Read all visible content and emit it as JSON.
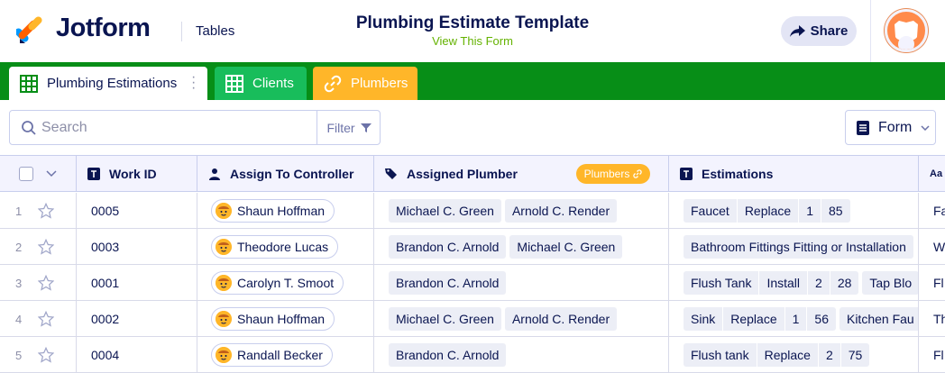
{
  "header": {
    "brand": "Jotform",
    "section": "Tables",
    "title": "Plumbing Estimate Template",
    "subtitle_link": "View This Form",
    "share_label": "Share"
  },
  "tabs": [
    {
      "label": "Plumbing Estimations",
      "icon": "grid-icon"
    },
    {
      "label": "Clients",
      "icon": "grid-icon"
    },
    {
      "label": "Plumbers",
      "icon": "link-icon"
    }
  ],
  "toolbar": {
    "search_placeholder": "Search",
    "filter_label": "Filter",
    "form_label": "Form"
  },
  "columns": {
    "work_id": "Work ID",
    "assign": "Assign To Controller",
    "plumber": "Assigned Plumber",
    "plumber_link_tag": "Plumbers",
    "estimations": "Estimations",
    "next": "Aa"
  },
  "rows": [
    {
      "num": "1",
      "work_id": "0005",
      "controller": "Shaun Hoffman",
      "plumbers": [
        "Michael C. Green",
        "Arnold C. Render"
      ],
      "estimation": [
        "Faucet",
        "Replace",
        "1",
        "85"
      ],
      "estimation_extra": "",
      "next": "Fa"
    },
    {
      "num": "2",
      "work_id": "0003",
      "controller": "Theodore Lucas",
      "plumbers": [
        "Brandon C. Arnold",
        "Michael C. Green"
      ],
      "estimation": [
        "Bathroom Fittings Fitting or Installation"
      ],
      "estimation_extra": "",
      "next": "W"
    },
    {
      "num": "3",
      "work_id": "0001",
      "controller": "Carolyn T. Smoot",
      "plumbers": [
        "Brandon C. Arnold"
      ],
      "estimation": [
        "Flush Tank",
        "Install",
        "2",
        "28"
      ],
      "estimation_extra": "Tap Blo",
      "next": "Fl"
    },
    {
      "num": "4",
      "work_id": "0002",
      "controller": "Shaun Hoffman",
      "plumbers": [
        "Michael C. Green",
        "Arnold C. Render"
      ],
      "estimation": [
        "Sink",
        "Replace",
        "1",
        "56"
      ],
      "estimation_extra": "Kitchen Fau",
      "next": "Th"
    },
    {
      "num": "5",
      "work_id": "0004",
      "controller": "Randall Becker",
      "plumbers": [
        "Brandon C. Arnold"
      ],
      "estimation": [
        "Flush tank",
        "Replace",
        "2",
        "75"
      ],
      "estimation_extra": "",
      "next": "Fl"
    }
  ],
  "colors": {
    "tabbar_bg": "#078e17",
    "tab_clients": "#18bd5b",
    "tab_plumbers": "#ffb629",
    "navy": "#0a1551",
    "link_green": "#64b200"
  }
}
